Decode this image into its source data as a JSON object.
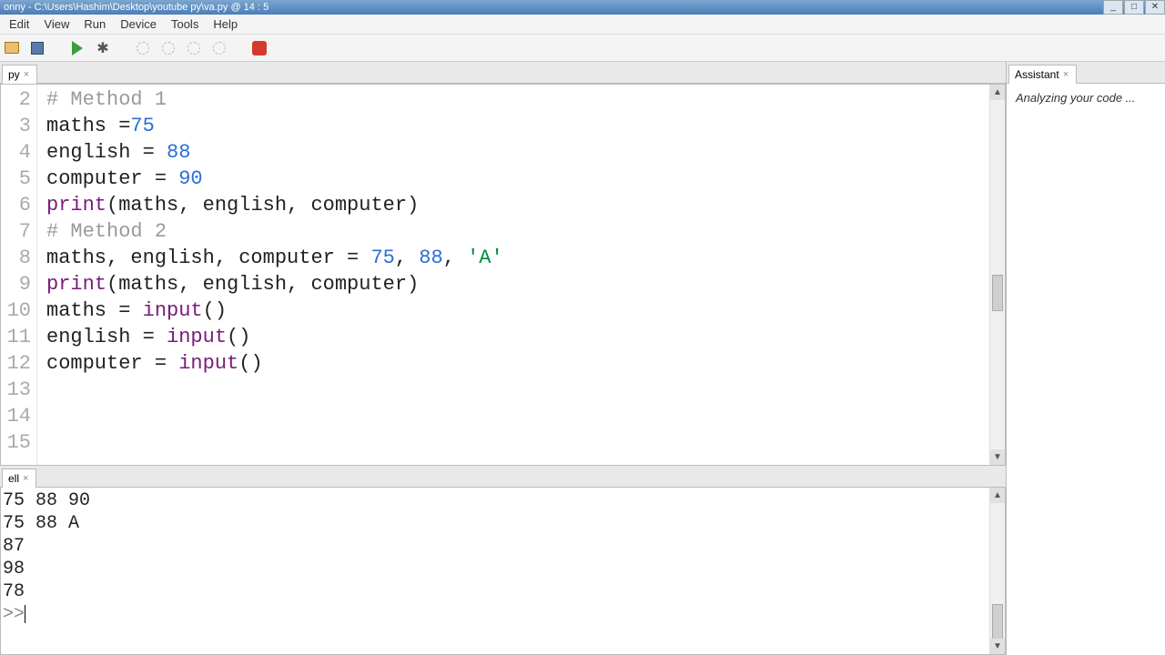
{
  "window": {
    "title": "onny  -  C:\\Users\\Hashim\\Desktop\\youtube py\\va.py  @  14 : 5"
  },
  "menu": [
    "Edit",
    "View",
    "Run",
    "Device",
    "Tools",
    "Help"
  ],
  "editor": {
    "tab_label": "py",
    "gutter_start": 2,
    "lines": [
      {
        "n": 2,
        "segs": [
          {
            "t": "",
            "c": ""
          }
        ]
      },
      {
        "n": 3,
        "segs": [
          {
            "t": "# Method 1",
            "c": "tok-comment"
          }
        ]
      },
      {
        "n": 4,
        "segs": [
          {
            "t": "maths =",
            "c": ""
          },
          {
            "t": "75",
            "c": "tok-num"
          }
        ]
      },
      {
        "n": 5,
        "segs": [
          {
            "t": "english = ",
            "c": ""
          },
          {
            "t": "88",
            "c": "tok-num"
          }
        ]
      },
      {
        "n": 6,
        "segs": [
          {
            "t": "computer = ",
            "c": ""
          },
          {
            "t": "90",
            "c": "tok-num"
          }
        ]
      },
      {
        "n": 7,
        "segs": [
          {
            "t": "print",
            "c": "tok-builtin"
          },
          {
            "t": "(maths, english, computer)",
            "c": ""
          }
        ]
      },
      {
        "n": 8,
        "segs": [
          {
            "t": "",
            "c": ""
          }
        ]
      },
      {
        "n": 9,
        "segs": [
          {
            "t": "# Method 2",
            "c": "tok-comment"
          }
        ]
      },
      {
        "n": 10,
        "segs": [
          {
            "t": "maths, english, computer = ",
            "c": ""
          },
          {
            "t": "75",
            "c": "tok-num"
          },
          {
            "t": ", ",
            "c": ""
          },
          {
            "t": "88",
            "c": "tok-num"
          },
          {
            "t": ", ",
            "c": ""
          },
          {
            "t": "'A'",
            "c": "tok-str"
          }
        ]
      },
      {
        "n": 11,
        "segs": [
          {
            "t": "print",
            "c": "tok-builtin"
          },
          {
            "t": "(maths, english, computer)",
            "c": ""
          }
        ]
      },
      {
        "n": 12,
        "segs": [
          {
            "t": "",
            "c": ""
          }
        ]
      },
      {
        "n": 13,
        "segs": [
          {
            "t": "maths = ",
            "c": ""
          },
          {
            "t": "input",
            "c": "tok-builtin"
          },
          {
            "t": "()",
            "c": ""
          }
        ]
      },
      {
        "n": 14,
        "segs": [
          {
            "t": "english = ",
            "c": ""
          },
          {
            "t": "input",
            "c": "tok-builtin"
          },
          {
            "t": "()",
            "c": ""
          }
        ]
      },
      {
        "n": 15,
        "segs": [
          {
            "t": "computer = ",
            "c": ""
          },
          {
            "t": "input",
            "c": "tok-builtin"
          },
          {
            "t": "()",
            "c": ""
          }
        ]
      }
    ]
  },
  "shell": {
    "tab_label": "ell",
    "lines": [
      "75 88 90",
      "75 88 A",
      "87",
      "98",
      "78"
    ],
    "prompt": ">>"
  },
  "assistant": {
    "tab_label": "Assistant",
    "status": "Analyzing your code ..."
  }
}
